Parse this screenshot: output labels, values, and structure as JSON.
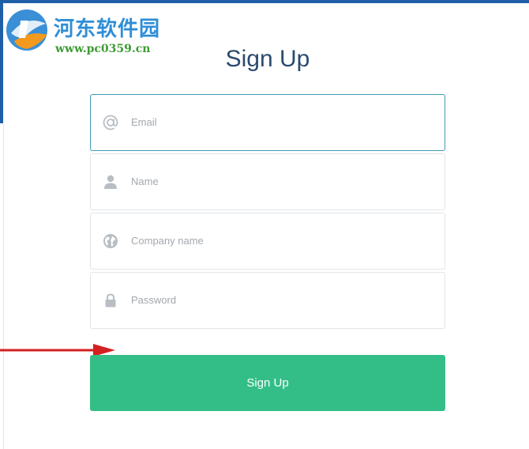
{
  "watermark": {
    "title": "河东软件园",
    "url": "www.pc0359.cn"
  },
  "form": {
    "title": "Sign Up",
    "fields": [
      {
        "icon": "at-icon",
        "placeholder": "Email",
        "focused": true
      },
      {
        "icon": "person-icon",
        "placeholder": "Name",
        "focused": false
      },
      {
        "icon": "globe-icon",
        "placeholder": "Company name",
        "focused": false
      },
      {
        "icon": "lock-icon",
        "placeholder": "Password",
        "focused": false
      }
    ],
    "submit_label": "Sign Up"
  },
  "colors": {
    "accent_blue": "#1f5fa8",
    "title": "#2b4a6e",
    "focus_border": "#3f9cb3",
    "button": "#33be87",
    "placeholder": "#a3a8ae",
    "annotation_arrow": "#d42020"
  }
}
